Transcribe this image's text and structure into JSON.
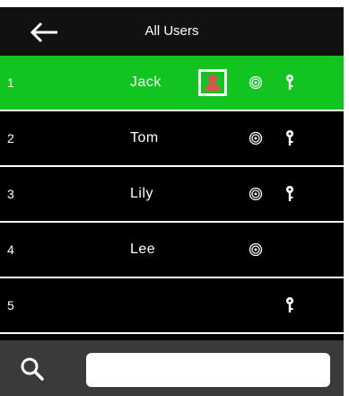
{
  "header": {
    "title": "All Users",
    "back_icon": "arrow-left-icon"
  },
  "users": [
    {
      "number": "1",
      "name": "Jack",
      "selected": true,
      "face": true,
      "fingerprint": true,
      "password": true
    },
    {
      "number": "2",
      "name": "Tom",
      "selected": false,
      "face": false,
      "fingerprint": true,
      "password": true
    },
    {
      "number": "3",
      "name": "Lily",
      "selected": false,
      "face": false,
      "fingerprint": true,
      "password": true
    },
    {
      "number": "4",
      "name": "Lee",
      "selected": false,
      "face": false,
      "fingerprint": true,
      "password": false
    },
    {
      "number": "5",
      "name": "",
      "selected": false,
      "face": false,
      "fingerprint": false,
      "password": true
    }
  ],
  "footer": {
    "search_icon": "search-icon",
    "search_value": ""
  },
  "colors": {
    "selected_row": "#11c41f",
    "background": "#000000",
    "footer": "#3a3a3a",
    "face_icon": "#e05050"
  }
}
